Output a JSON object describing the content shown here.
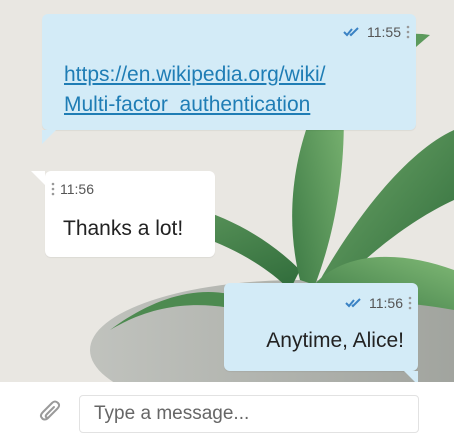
{
  "colors": {
    "outgoing_bubble": "#d3ebf7",
    "incoming_bubble": "#ffffff",
    "link": "#1f7db5",
    "read_ticks": "#3a82c4"
  },
  "messages": [
    {
      "direction": "outgoing",
      "time": "11:55",
      "status_icon": "double-check-icon",
      "link_parts": [
        "https://en.wikipedia.org/wiki/",
        "Multi-factor_authentication"
      ]
    },
    {
      "direction": "incoming",
      "time": "11:56",
      "text": "Thanks a lot!"
    },
    {
      "direction": "outgoing",
      "time": "11:56",
      "status_icon": "double-check-icon",
      "text": "Anytime, Alice!"
    }
  ],
  "composer": {
    "attach_icon": "paperclip-icon",
    "placeholder": "Type a message..."
  }
}
